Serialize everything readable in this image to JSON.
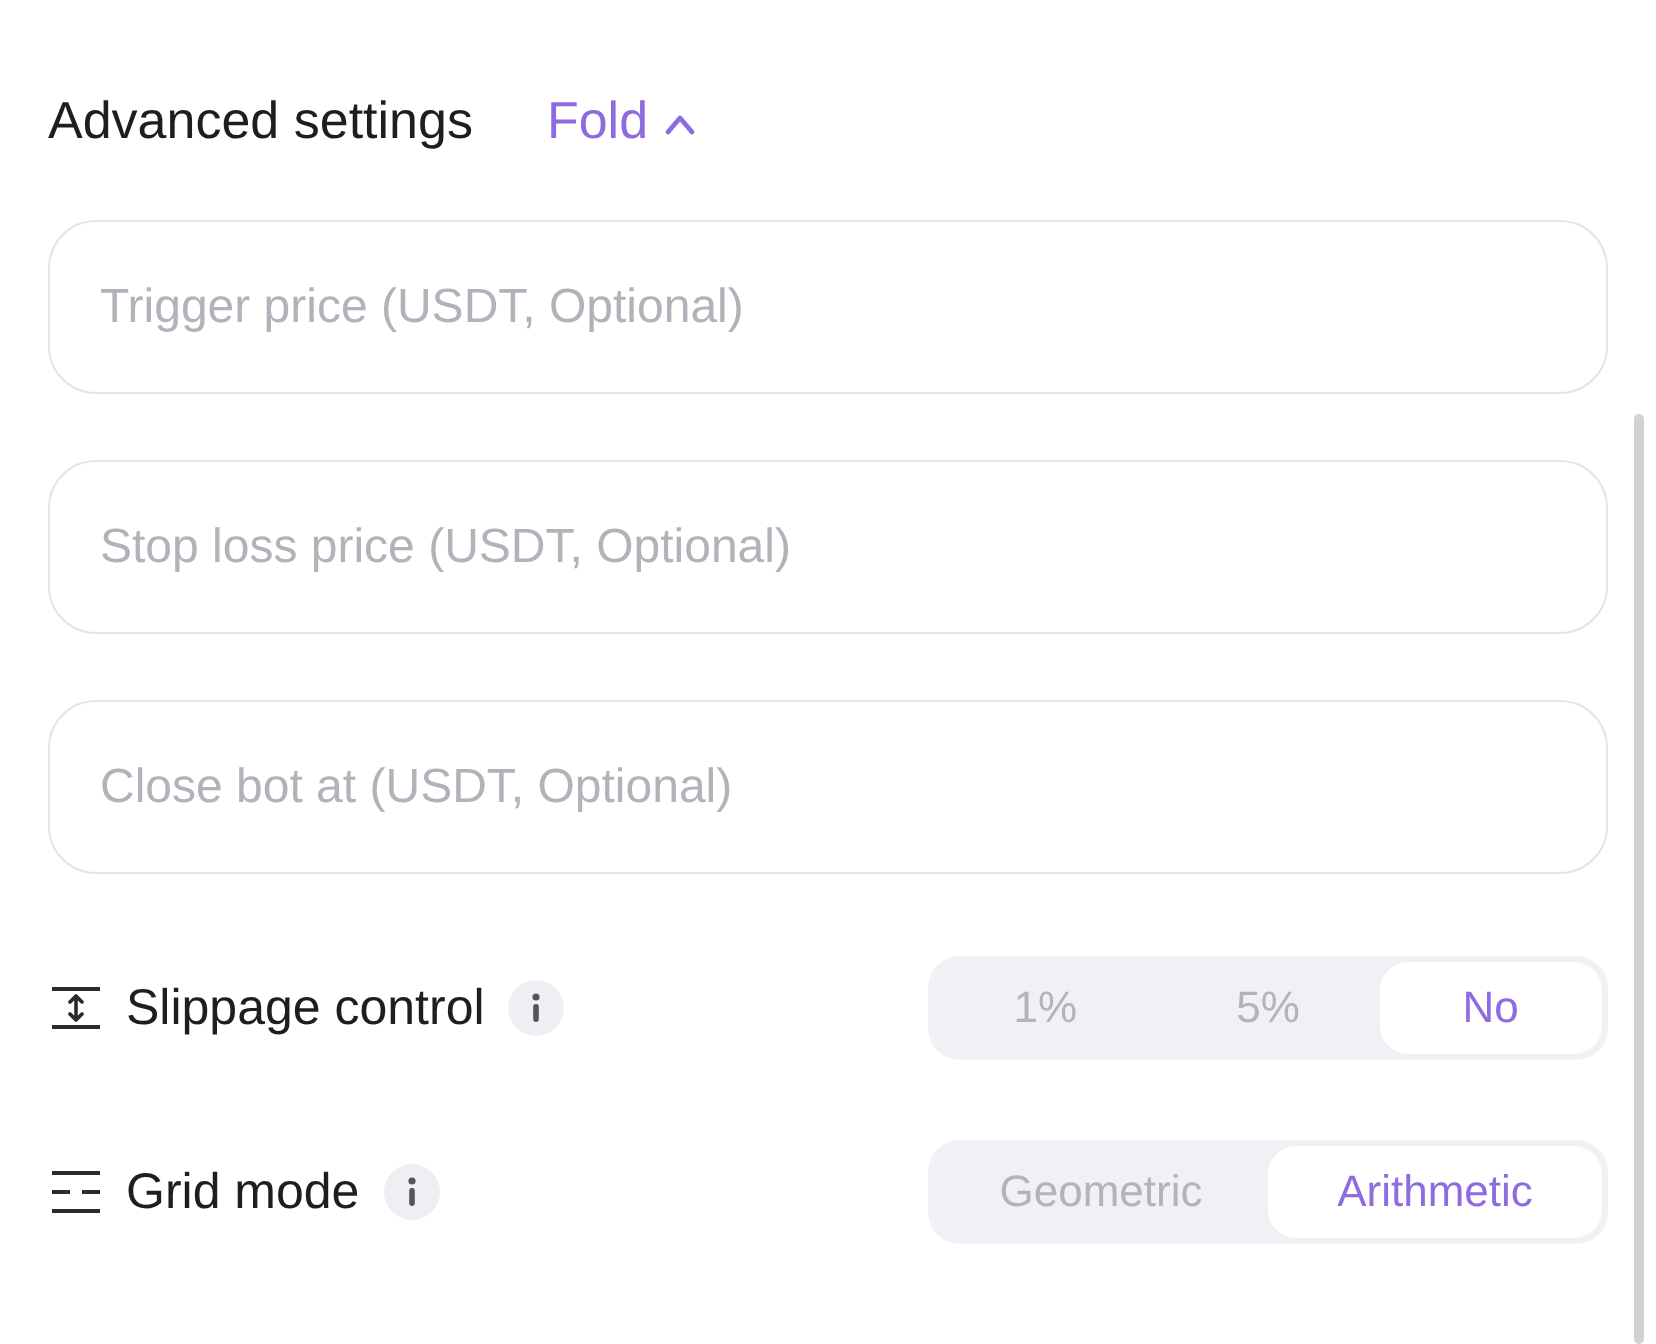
{
  "header": {
    "title": "Advanced settings",
    "toggle": {
      "label": "Fold",
      "expanded": true
    }
  },
  "fields": [
    {
      "placeholder": "Trigger price (USDT, Optional)"
    },
    {
      "placeholder": "Stop loss price (USDT, Optional)"
    },
    {
      "placeholder": "Close bot at (USDT, Optional)"
    }
  ],
  "settings": [
    {
      "kind": "slippage",
      "label": "Slippage control",
      "options": [
        {
          "label": "1%",
          "selected": false
        },
        {
          "label": "5%",
          "selected": false
        },
        {
          "label": "No",
          "selected": true
        }
      ]
    },
    {
      "kind": "grid",
      "label": "Grid mode",
      "options": [
        {
          "label": "Geometric",
          "selected": false
        },
        {
          "label": "Arithmetic",
          "selected": true
        }
      ]
    }
  ]
}
